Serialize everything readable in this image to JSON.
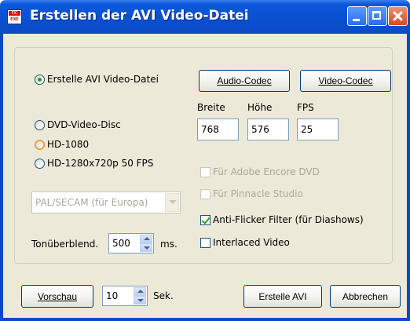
{
  "window": {
    "title": "Erstellen der AVI Video-Datei",
    "app_icon_top": "PIC",
    "app_icon_bottom": "EXE"
  },
  "codec_buttons": {
    "audio": "Audio-Codec",
    "video": "Video-Codec"
  },
  "mode_radios": [
    {
      "label": "Erstelle AVI Video-Datei",
      "checked": true
    },
    {
      "label": "DVD-Video-Disc",
      "checked": false
    },
    {
      "label": "HD-1080",
      "checked": false
    },
    {
      "label": "HD-1280x720p 50 FPS",
      "checked": false
    }
  ],
  "video_format": {
    "selected": "PAL/SECAM (für Europa)"
  },
  "dimensions": {
    "width_label": "Breite",
    "width_value": "768",
    "height_label": "Höhe",
    "height_value": "576",
    "fps_label": "FPS",
    "fps_value": "25"
  },
  "options": [
    {
      "label": "Für Adobe Encore DVD",
      "checked": false,
      "enabled": false
    },
    {
      "label": "Für Pinnacle Studio",
      "checked": false,
      "enabled": false
    },
    {
      "label": "Anti-Flicker Filter (für Diashows)",
      "checked": true,
      "enabled": true
    },
    {
      "label": "Interlaced Video",
      "checked": false,
      "enabled": true
    }
  ],
  "crossfade": {
    "label": "Tonüberblend.",
    "value": "500",
    "unit": "ms."
  },
  "footer": {
    "preview_label": "Vorschau",
    "preview_seconds": "10",
    "seconds_unit": "Sek.",
    "create_label": "Erstelle AVI",
    "cancel_label": "Abbrechen"
  }
}
